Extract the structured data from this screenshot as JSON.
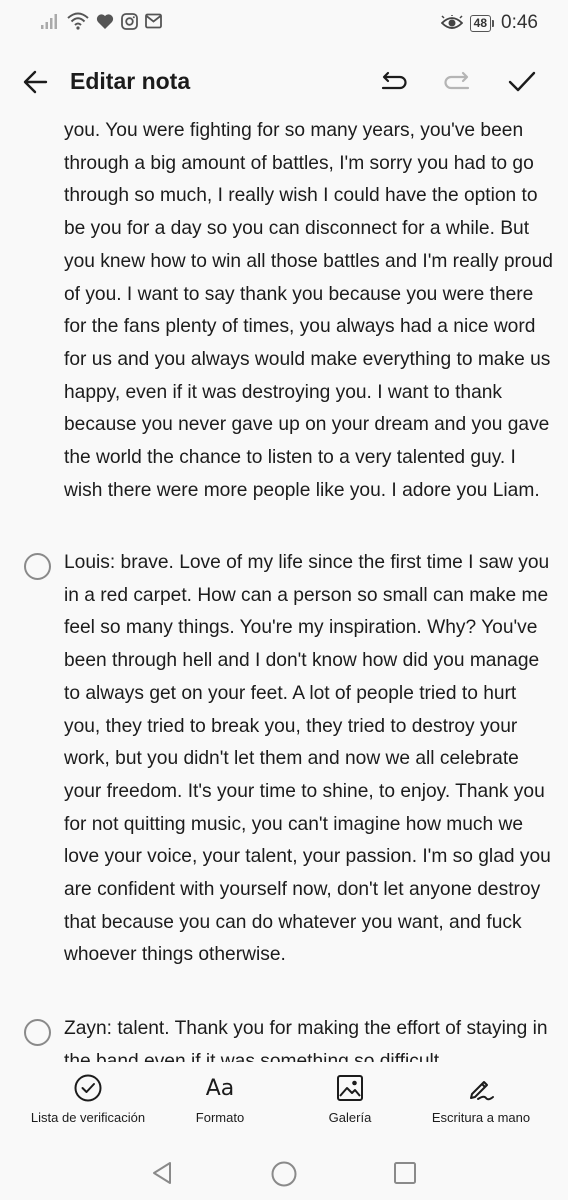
{
  "status_bar": {
    "time": "0:46",
    "battery": "48",
    "icons": [
      "signal-icon",
      "wifi-icon",
      "heart-icon",
      "instagram-icon",
      "gmail-icon",
      "eye-icon"
    ]
  },
  "toolbar": {
    "title": "Editar nota",
    "back_icon": "arrow-back-icon",
    "undo_icon": "undo-icon",
    "redo_icon": "redo-icon",
    "done_icon": "check-icon"
  },
  "note": {
    "intro_paragraph": "you. You were fighting for so many years, you've been through a big amount of battles, I'm sorry you had to go through so much, I really wish I could have the option to be you for a day so you can disconnect for a while. But you knew how to win all those battles and I'm really proud of you. I want to say thank you because you were there for the fans plenty of times, you always had a nice word for us and you always would make everything to make us happy, even if it was destroying you. I want to thank because you never gave up on your dream and you gave the world the chance to listen to a very talented guy. I wish there were more people like you. I adore you Liam.",
    "items": [
      {
        "checked": false,
        "text": "Louis: brave. Love of my life since the first time I saw you in a red carpet. How can a person so small can make me feel so many things. You're my inspiration. Why? You've been through hell and I don't know how did you manage to always get on your feet. A lot of people tried to hurt you, they tried to break you, they tried to destroy your work, but you didn't let them and now we all celebrate your freedom. It's your time to shine, to enjoy. Thank you for not quitting music, you can't imagine how much we love your voice, your talent, your passion. I'm so glad you are confident with yourself now, don't let anyone destroy that because you can do whatever you want, and fuck whoever things otherwise."
      },
      {
        "checked": false,
        "text": "Zayn: talent. Thank you for making the effort of staying in the band even if it was something so difficult"
      }
    ]
  },
  "bottom_bar": {
    "checklist": "Lista de verificación",
    "format": "Formato",
    "format_glyph": "Aa",
    "gallery": "Galería",
    "handwriting": "Escritura a mano"
  },
  "nav_bar": {
    "icons": [
      "back-triangle-icon",
      "home-circle-icon",
      "recents-square-icon"
    ]
  }
}
